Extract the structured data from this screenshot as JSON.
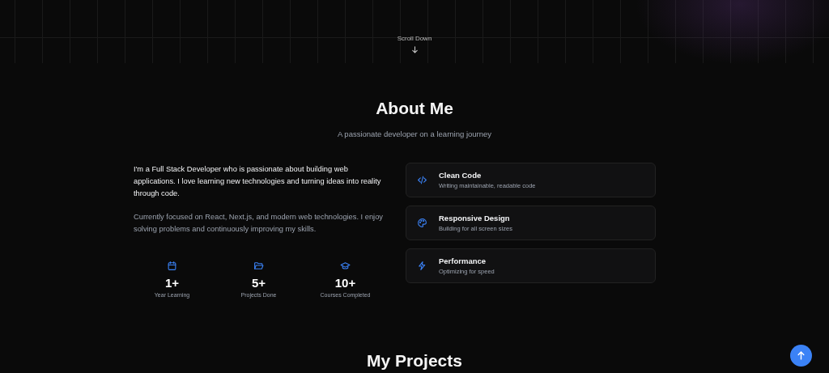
{
  "hero": {
    "scroll_hint": "Scroll Down"
  },
  "about": {
    "title": "About Me",
    "subtitle": "A passionate developer on a learning journey",
    "paragraphs": [
      "I'm a Full Stack Developer who is passionate about building web applications. I love learning new technologies and turning ideas into reality through code.",
      "Currently focused on React, Next.js, and modern web technologies. I enjoy solving problems and continuously improving my skills."
    ],
    "stats": [
      {
        "kind": "calendar",
        "value": "1+",
        "label": "Year Learning"
      },
      {
        "kind": "folder",
        "value": "5+",
        "label": "Projects Done"
      },
      {
        "kind": "cap",
        "value": "10+",
        "label": "Courses Completed"
      }
    ],
    "features": [
      {
        "kind": "code",
        "title": "Clean Code",
        "description": "Writing maintainable, readable code"
      },
      {
        "kind": "palette",
        "title": "Responsive Design",
        "description": "Building for all screen sizes"
      },
      {
        "kind": "bolt",
        "title": "Performance",
        "description": "Optimizing for speed"
      }
    ]
  },
  "projects": {
    "title": "My Projects"
  }
}
